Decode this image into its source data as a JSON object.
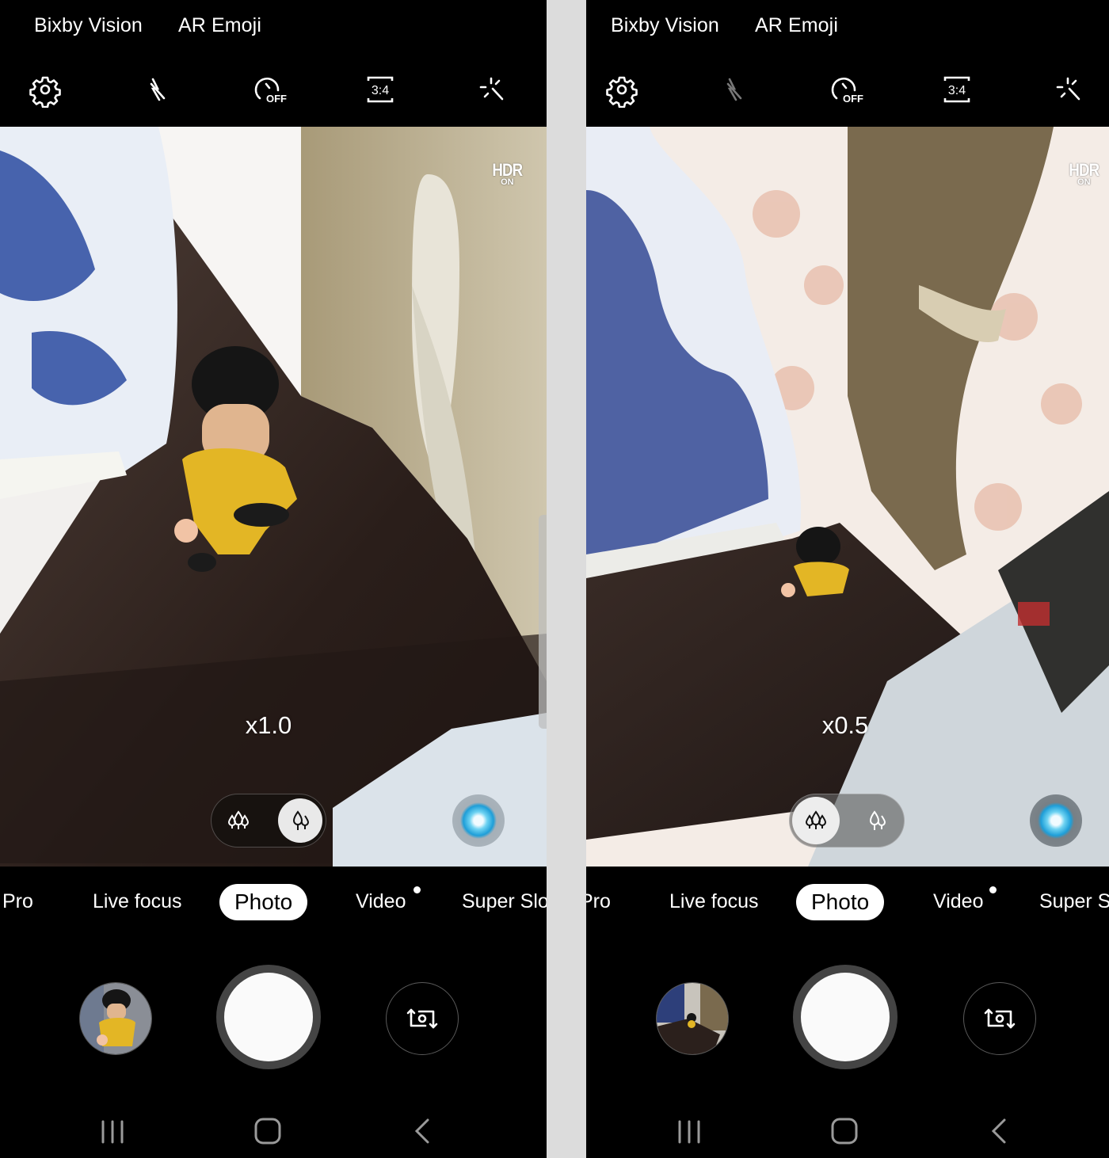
{
  "panels": [
    {
      "id": "left",
      "top_links": [
        "Bixby Vision",
        "AR Emoji"
      ],
      "quick_settings": [
        {
          "icon": "gear-icon",
          "label": "Settings",
          "state": "enabled"
        },
        {
          "icon": "flash-off-icon",
          "label": "Flash off",
          "state": "enabled"
        },
        {
          "icon": "timer-off-icon",
          "label": "Timer",
          "value": "OFF"
        },
        {
          "icon": "aspect-ratio-icon",
          "label": "Ratio",
          "value": "3:4"
        },
        {
          "icon": "effects-wand-icon",
          "label": "Effects"
        }
      ],
      "hdr": {
        "label": "HDR",
        "state": "ON"
      },
      "zoom_level": "x1.0",
      "lens_selector": {
        "options": [
          "wide-angle",
          "normal"
        ],
        "selected": "normal"
      },
      "modes": [
        "Pro",
        "Live focus",
        "Photo",
        "Video",
        "Super Slo"
      ],
      "active_mode": "Photo",
      "video_badge": true,
      "scene": "close-up of yellow-suited figurine on dark wooden table next to blue-and-white vase"
    },
    {
      "id": "right",
      "top_links": [
        "Bixby Vision",
        "AR Emoji"
      ],
      "quick_settings": [
        {
          "icon": "gear-icon",
          "label": "Settings",
          "state": "enabled"
        },
        {
          "icon": "flash-off-icon",
          "label": "Flash off",
          "state": "disabled"
        },
        {
          "icon": "timer-off-icon",
          "label": "Timer",
          "value": "OFF"
        },
        {
          "icon": "aspect-ratio-icon",
          "label": "Ratio",
          "value": "3:4"
        },
        {
          "icon": "effects-wand-icon",
          "label": "Effects"
        }
      ],
      "hdr": {
        "label": "HDR",
        "state": "ON"
      },
      "zoom_level": "x0.5",
      "lens_selector": {
        "options": [
          "wide-angle",
          "normal"
        ],
        "selected": "wide-angle"
      },
      "modes": [
        "Pro",
        "Live focus",
        "Photo",
        "Video",
        "Super S"
      ],
      "active_mode": "Photo",
      "video_badge": true,
      "scene": "wide-angle view of figurine, vase, curtains and window"
    }
  ],
  "nav": {
    "recents": "Recent apps",
    "home": "Home",
    "back": "Back"
  },
  "colors": {
    "background": "#000000",
    "divider": "#dcdcdc",
    "active_pill": "#ffffff",
    "shutter_ring": "#444444",
    "bixby_blue": "#1e9ed8"
  }
}
